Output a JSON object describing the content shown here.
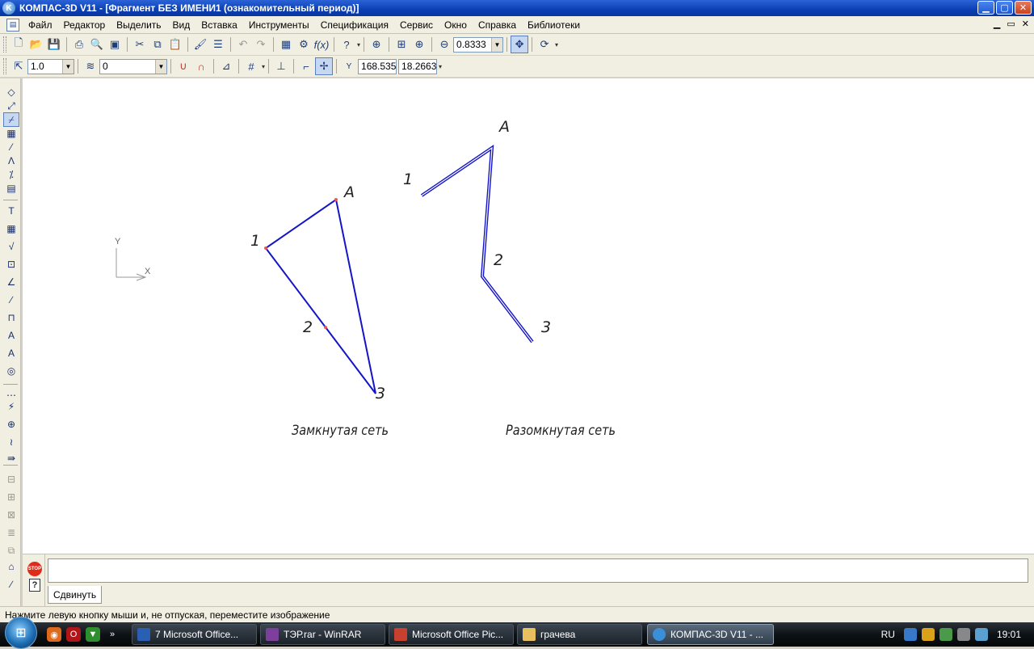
{
  "window": {
    "title": "КОМПАС-3D V11 - [Фрагмент БЕЗ ИМЕНИ1 (ознакомительный период)]",
    "min": "▁",
    "max": "▢",
    "close": "✕"
  },
  "menu": {
    "items": [
      "Файл",
      "Редактор",
      "Выделить",
      "Вид",
      "Вставка",
      "Инструменты",
      "Спецификация",
      "Сервис",
      "Окно",
      "Справка",
      "Библиотеки"
    ],
    "mdi": [
      "▁",
      "▭",
      "✕"
    ]
  },
  "toolbar1": {
    "zoom_value": "0.8333"
  },
  "toolbar2": {
    "scale_value": "1.0",
    "layer_value": "0",
    "coord_x": "168.535",
    "coord_y": "18.2663",
    "coord_prefix": "Y"
  },
  "canvas": {
    "axis_y": "Y",
    "axis_x": "X",
    "closed_net": {
      "label_a": "A",
      "label_1": "1",
      "label_2": "2",
      "label_3": "3",
      "caption": "Замкнутая сеть"
    },
    "open_net": {
      "label_a": "A",
      "label_1": "1",
      "label_2": "2",
      "label_3": "3",
      "caption": "Разомкнутая сеть"
    },
    "line_color": "#1414c8"
  },
  "panel": {
    "stop_label": "STOP",
    "help_label": "?",
    "tab_label": "Сдвинуть"
  },
  "status": {
    "text": "Нажмите левую кнопку мыши и, не отпуская, переместите изображение"
  },
  "taskbar": {
    "tasks": [
      "7 Microsoft Office...",
      "ТЭР.rar - WinRAR",
      "Microsoft Office Pic...",
      "грачева",
      "КОМПАС-3D V11 - ..."
    ],
    "lang": "RU",
    "clock": "19:01"
  }
}
